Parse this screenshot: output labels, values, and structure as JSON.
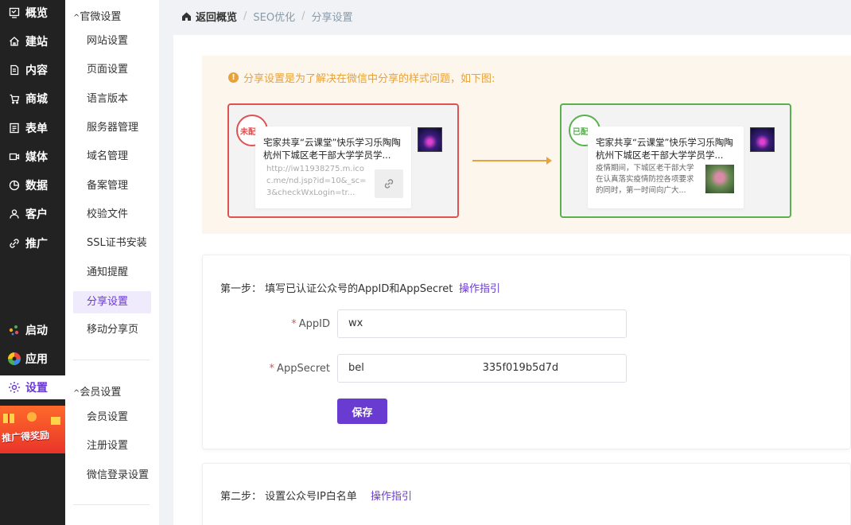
{
  "nav": {
    "items": [
      {
        "label": "概览",
        "icon": "overview-icon"
      },
      {
        "label": "建站",
        "icon": "home-icon"
      },
      {
        "label": "内容",
        "icon": "document-icon"
      },
      {
        "label": "商城",
        "icon": "cart-icon"
      },
      {
        "label": "表单",
        "icon": "form-icon"
      },
      {
        "label": "媒体",
        "icon": "media-icon"
      },
      {
        "label": "数据",
        "icon": "chart-icon"
      },
      {
        "label": "客户",
        "icon": "user-icon"
      },
      {
        "label": "推广",
        "icon": "promote-icon"
      }
    ],
    "bottom": [
      {
        "label": "启动",
        "icon": "launch-icon"
      },
      {
        "label": "应用",
        "icon": "apps-icon"
      },
      {
        "label": "设置",
        "icon": "settings-icon"
      }
    ],
    "promo": "推广得奖励"
  },
  "submenu": {
    "group1_title": "官微设置",
    "group1_items": [
      "网站设置",
      "页面设置",
      "语言版本",
      "服务器管理",
      "域名管理",
      "备案管理",
      "校验文件",
      "SSL证书安装",
      "通知提醒",
      "分享设置",
      "移动分享页"
    ],
    "group2_title": "会员设置",
    "group2_items": [
      "会员设置",
      "注册设置",
      "微信登录设置"
    ]
  },
  "breadcrumb": {
    "home": "返回概览",
    "sep": "/",
    "level1": "SEO优化",
    "level2": "分享设置"
  },
  "notice": {
    "tip": "分享设置是为了解决在微信中分享的样式问题，如下图:",
    "bad_stamp": "未配置",
    "good_stamp": "已配置",
    "card_title": "宅家共享“云课堂”快乐学习乐陶陶 杭州下城区老干部大学学员学...",
    "bad_url": "http://iw11938275.m.icoc.me/nd.jsp?id=10&_sc=3&checkWxLogin=tr...",
    "good_desc": "疫情期间，下城区老干部大学在认真落实疫情防控各项要求的同时，第一时间向广大..."
  },
  "step1": {
    "title": "第一步：  填写已认证公众号的AppID和AppSecret",
    "guide": "操作指引",
    "appid_label": "AppID",
    "appid_value": "wx",
    "appsecret_label": "AppSecret",
    "appsecret_value": "bel                                    335f019b5d7d",
    "required_mark": "*",
    "save": "保存"
  },
  "step2": {
    "title": "第二步：  设置公众号IP白名单",
    "guide": "操作指引"
  },
  "colors": {
    "accent": "#6a3bd0",
    "warning": "#e6a23c",
    "error": "#e05252",
    "success": "#59b14d"
  }
}
